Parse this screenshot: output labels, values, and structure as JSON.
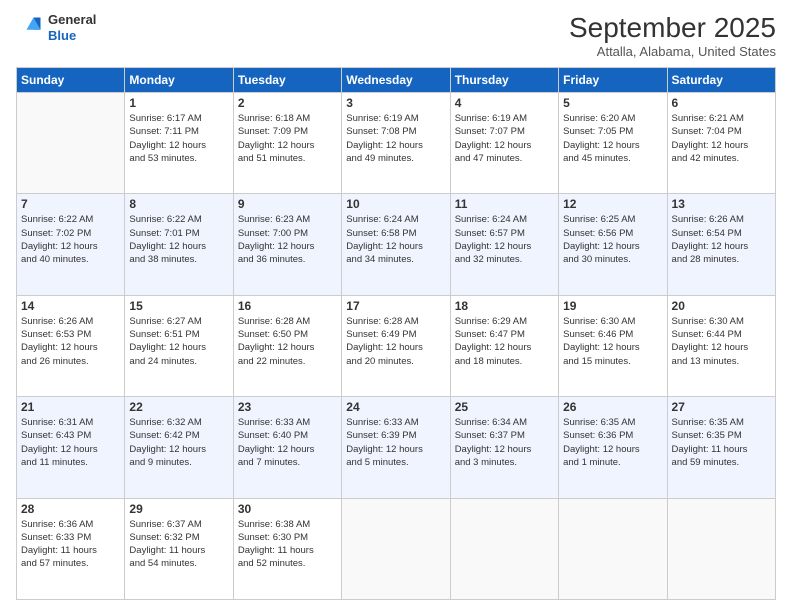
{
  "logo": {
    "line1": "General",
    "line2": "Blue"
  },
  "title": "September 2025",
  "location": "Attalla, Alabama, United States",
  "days_of_week": [
    "Sunday",
    "Monday",
    "Tuesday",
    "Wednesday",
    "Thursday",
    "Friday",
    "Saturday"
  ],
  "weeks": [
    [
      {
        "day": "",
        "info": ""
      },
      {
        "day": "1",
        "info": "Sunrise: 6:17 AM\nSunset: 7:11 PM\nDaylight: 12 hours\nand 53 minutes."
      },
      {
        "day": "2",
        "info": "Sunrise: 6:18 AM\nSunset: 7:09 PM\nDaylight: 12 hours\nand 51 minutes."
      },
      {
        "day": "3",
        "info": "Sunrise: 6:19 AM\nSunset: 7:08 PM\nDaylight: 12 hours\nand 49 minutes."
      },
      {
        "day": "4",
        "info": "Sunrise: 6:19 AM\nSunset: 7:07 PM\nDaylight: 12 hours\nand 47 minutes."
      },
      {
        "day": "5",
        "info": "Sunrise: 6:20 AM\nSunset: 7:05 PM\nDaylight: 12 hours\nand 45 minutes."
      },
      {
        "day": "6",
        "info": "Sunrise: 6:21 AM\nSunset: 7:04 PM\nDaylight: 12 hours\nand 42 minutes."
      }
    ],
    [
      {
        "day": "7",
        "info": "Sunrise: 6:22 AM\nSunset: 7:02 PM\nDaylight: 12 hours\nand 40 minutes."
      },
      {
        "day": "8",
        "info": "Sunrise: 6:22 AM\nSunset: 7:01 PM\nDaylight: 12 hours\nand 38 minutes."
      },
      {
        "day": "9",
        "info": "Sunrise: 6:23 AM\nSunset: 7:00 PM\nDaylight: 12 hours\nand 36 minutes."
      },
      {
        "day": "10",
        "info": "Sunrise: 6:24 AM\nSunset: 6:58 PM\nDaylight: 12 hours\nand 34 minutes."
      },
      {
        "day": "11",
        "info": "Sunrise: 6:24 AM\nSunset: 6:57 PM\nDaylight: 12 hours\nand 32 minutes."
      },
      {
        "day": "12",
        "info": "Sunrise: 6:25 AM\nSunset: 6:56 PM\nDaylight: 12 hours\nand 30 minutes."
      },
      {
        "day": "13",
        "info": "Sunrise: 6:26 AM\nSunset: 6:54 PM\nDaylight: 12 hours\nand 28 minutes."
      }
    ],
    [
      {
        "day": "14",
        "info": "Sunrise: 6:26 AM\nSunset: 6:53 PM\nDaylight: 12 hours\nand 26 minutes."
      },
      {
        "day": "15",
        "info": "Sunrise: 6:27 AM\nSunset: 6:51 PM\nDaylight: 12 hours\nand 24 minutes."
      },
      {
        "day": "16",
        "info": "Sunrise: 6:28 AM\nSunset: 6:50 PM\nDaylight: 12 hours\nand 22 minutes."
      },
      {
        "day": "17",
        "info": "Sunrise: 6:28 AM\nSunset: 6:49 PM\nDaylight: 12 hours\nand 20 minutes."
      },
      {
        "day": "18",
        "info": "Sunrise: 6:29 AM\nSunset: 6:47 PM\nDaylight: 12 hours\nand 18 minutes."
      },
      {
        "day": "19",
        "info": "Sunrise: 6:30 AM\nSunset: 6:46 PM\nDaylight: 12 hours\nand 15 minutes."
      },
      {
        "day": "20",
        "info": "Sunrise: 6:30 AM\nSunset: 6:44 PM\nDaylight: 12 hours\nand 13 minutes."
      }
    ],
    [
      {
        "day": "21",
        "info": "Sunrise: 6:31 AM\nSunset: 6:43 PM\nDaylight: 12 hours\nand 11 minutes."
      },
      {
        "day": "22",
        "info": "Sunrise: 6:32 AM\nSunset: 6:42 PM\nDaylight: 12 hours\nand 9 minutes."
      },
      {
        "day": "23",
        "info": "Sunrise: 6:33 AM\nSunset: 6:40 PM\nDaylight: 12 hours\nand 7 minutes."
      },
      {
        "day": "24",
        "info": "Sunrise: 6:33 AM\nSunset: 6:39 PM\nDaylight: 12 hours\nand 5 minutes."
      },
      {
        "day": "25",
        "info": "Sunrise: 6:34 AM\nSunset: 6:37 PM\nDaylight: 12 hours\nand 3 minutes."
      },
      {
        "day": "26",
        "info": "Sunrise: 6:35 AM\nSunset: 6:36 PM\nDaylight: 12 hours\nand 1 minute."
      },
      {
        "day": "27",
        "info": "Sunrise: 6:35 AM\nSunset: 6:35 PM\nDaylight: 11 hours\nand 59 minutes."
      }
    ],
    [
      {
        "day": "28",
        "info": "Sunrise: 6:36 AM\nSunset: 6:33 PM\nDaylight: 11 hours\nand 57 minutes."
      },
      {
        "day": "29",
        "info": "Sunrise: 6:37 AM\nSunset: 6:32 PM\nDaylight: 11 hours\nand 54 minutes."
      },
      {
        "day": "30",
        "info": "Sunrise: 6:38 AM\nSunset: 6:30 PM\nDaylight: 11 hours\nand 52 minutes."
      },
      {
        "day": "",
        "info": ""
      },
      {
        "day": "",
        "info": ""
      },
      {
        "day": "",
        "info": ""
      },
      {
        "day": "",
        "info": ""
      }
    ]
  ]
}
